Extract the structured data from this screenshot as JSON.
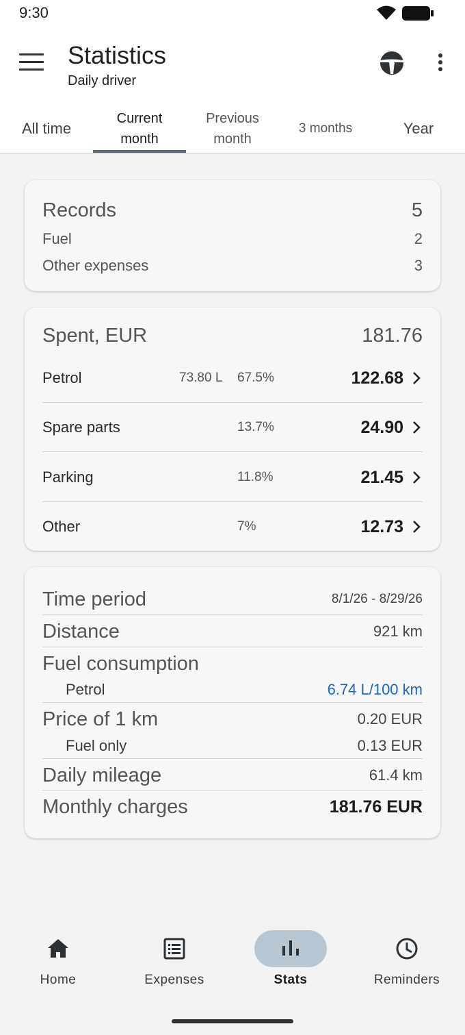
{
  "status": {
    "time": "9:30"
  },
  "appbar": {
    "title": "Statistics",
    "subtitle": "Daily driver"
  },
  "tabs": [
    "All time",
    "Current month",
    "Previous month",
    "3 months",
    "Year"
  ],
  "active_tab": "Current month",
  "records": {
    "title": "Records",
    "total": "5",
    "items": [
      {
        "label": "Fuel",
        "value": "2"
      },
      {
        "label": "Other expenses",
        "value": "3"
      }
    ]
  },
  "spent": {
    "title": "Spent, EUR",
    "total": "181.76",
    "items": [
      {
        "label": "Petrol",
        "qty": "73.80 L",
        "pct": "67.5%",
        "amount": "122.68"
      },
      {
        "label": "Spare parts",
        "qty": "",
        "pct": "13.7%",
        "amount": "24.90"
      },
      {
        "label": "Parking",
        "qty": "",
        "pct": "11.8%",
        "amount": "21.45"
      },
      {
        "label": "Other",
        "qty": "",
        "pct": "7%",
        "amount": "12.73"
      }
    ]
  },
  "info": {
    "time_period_label": "Time period",
    "time_period_value": "8/1/26 - 8/29/26",
    "distance_label": "Distance",
    "distance_value": "921 km",
    "fuel_consumption_label": "Fuel consumption",
    "petrol_label": "Petrol",
    "petrol_value": "6.74 L/100 km",
    "price_label": "Price of 1 km",
    "price_value": "0.20 EUR",
    "fuel_only_label": "Fuel only",
    "fuel_only_value": "0.13 EUR",
    "daily_label": "Daily mileage",
    "daily_value": "61.4 km",
    "monthly_label": "Monthly charges",
    "monthly_value": "181.76 EUR"
  },
  "nav": [
    {
      "label": "Home",
      "icon": "home-icon"
    },
    {
      "label": "Expenses",
      "icon": "list-icon"
    },
    {
      "label": "Stats",
      "icon": "bar-chart-icon"
    },
    {
      "label": "Reminders",
      "icon": "clock-icon"
    }
  ],
  "nav_active": "Stats",
  "colors": {
    "accent_blue": "#1f66b3",
    "tab_indicator": "#5b6b78",
    "nav_pill": "#b7c6d0",
    "background": "#f2f3f5"
  }
}
